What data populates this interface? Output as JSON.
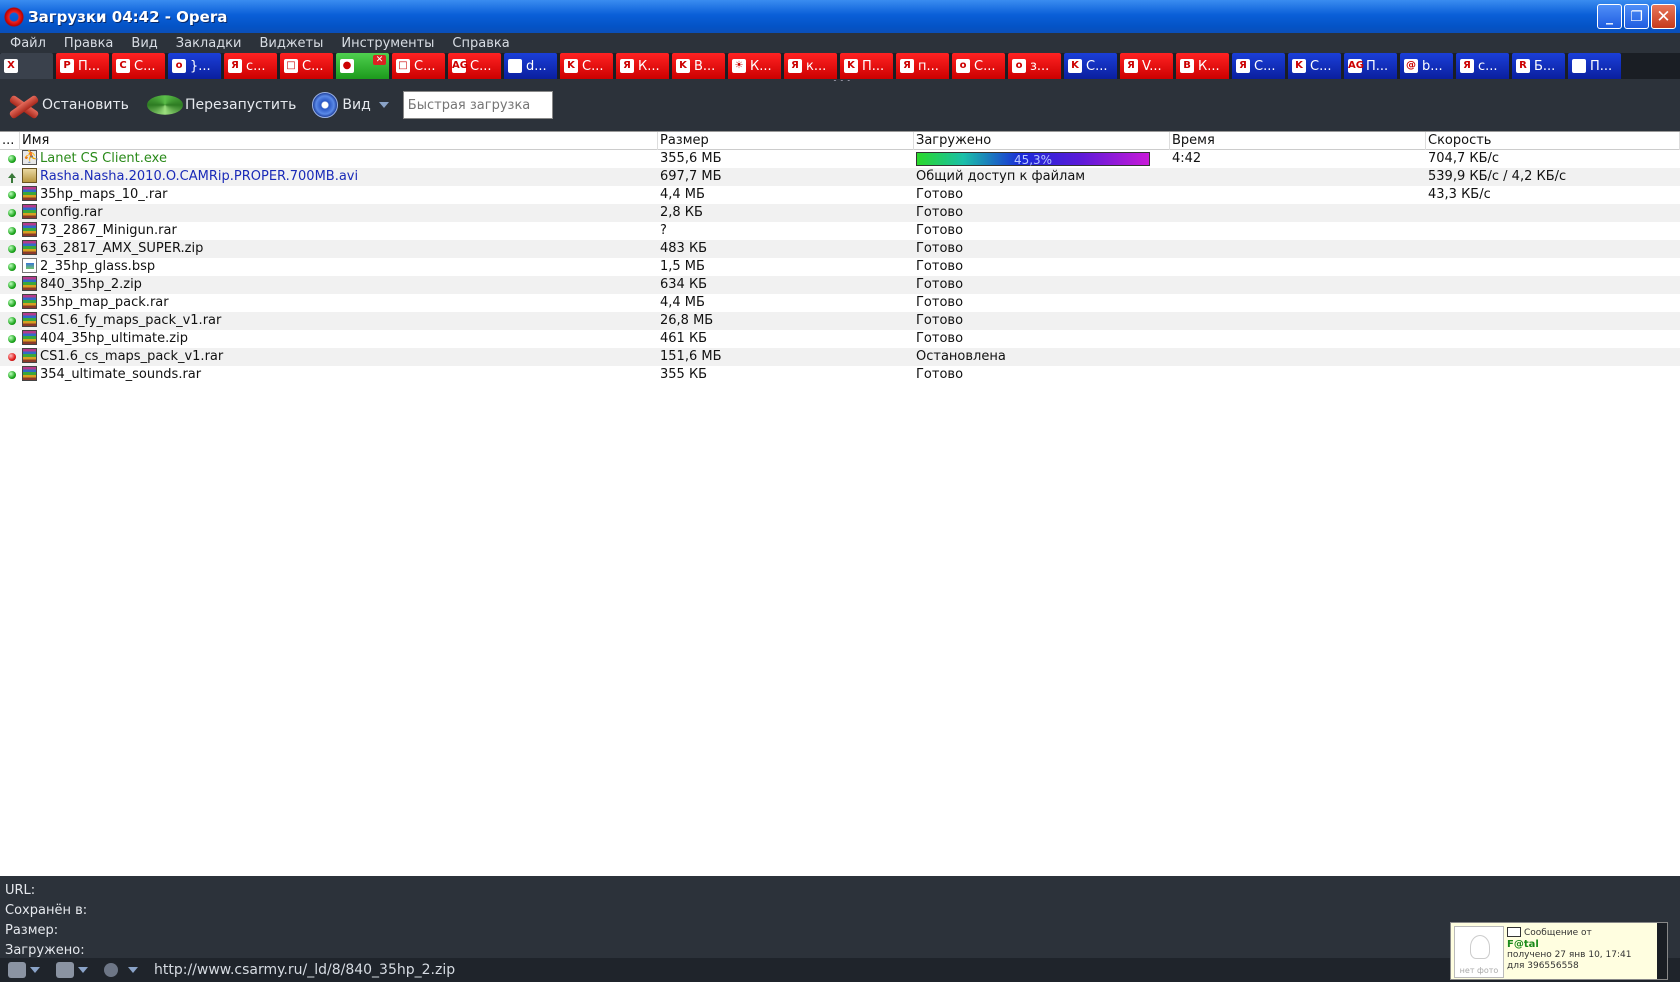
{
  "window": {
    "title": "Загрузки 04:42 - Opera",
    "min": "_",
    "max": "❐",
    "close": "✕"
  },
  "menu": [
    "Файл",
    "Правка",
    "Вид",
    "Закладки",
    "Виджеты",
    "Инструменты",
    "Справка"
  ],
  "tabs": [
    {
      "icon": "X",
      "text": "",
      "color": "gray"
    },
    {
      "icon": "P",
      "text": "П...",
      "color": "red"
    },
    {
      "icon": "C",
      "text": "С...",
      "color": "red"
    },
    {
      "icon": "o",
      "text": "}...",
      "color": "blue"
    },
    {
      "icon": "Я",
      "text": "с...",
      "color": "red"
    },
    {
      "icon": "□",
      "text": "С...",
      "color": "red"
    },
    {
      "icon": "●",
      "text": "",
      "color": "green",
      "closable": true
    },
    {
      "icon": "□",
      "text": "С...",
      "color": "red"
    },
    {
      "icon": "AG",
      "text": "С...",
      "color": "red"
    },
    {
      "icon": "",
      "text": "d...",
      "color": "blue"
    },
    {
      "icon": "K",
      "text": "С...",
      "color": "red"
    },
    {
      "icon": "Я",
      "text": "К...",
      "color": "red"
    },
    {
      "icon": "K",
      "text": "В...",
      "color": "red"
    },
    {
      "icon": "☀",
      "text": "К...",
      "color": "red"
    },
    {
      "icon": "Я",
      "text": "к...",
      "color": "red"
    },
    {
      "icon": "K",
      "text": "П...",
      "color": "red"
    },
    {
      "icon": "Я",
      "text": "п...",
      "color": "red"
    },
    {
      "icon": "o",
      "text": "С...",
      "color": "red"
    },
    {
      "icon": "o",
      "text": "з...",
      "color": "red"
    },
    {
      "icon": "K",
      "text": "С...",
      "color": "blue"
    },
    {
      "icon": "Я",
      "text": "V...",
      "color": "red"
    },
    {
      "icon": "B",
      "text": "К...",
      "color": "red"
    },
    {
      "icon": "Я",
      "text": "С...",
      "color": "blue"
    },
    {
      "icon": "K",
      "text": "С...",
      "color": "blue"
    },
    {
      "icon": "AG",
      "text": "П...",
      "color": "blue"
    },
    {
      "icon": "@",
      "text": "b...",
      "color": "blue"
    },
    {
      "icon": "Я",
      "text": "с...",
      "color": "blue"
    },
    {
      "icon": "R",
      "text": "Б...",
      "color": "blue"
    },
    {
      "icon": "",
      "text": "П...",
      "color": "blue"
    }
  ],
  "toolbar": {
    "stop_label": "Остановить",
    "restart_label": "Перезапустить",
    "view_label": "Вид",
    "quick_placeholder": "Быстрая загрузка"
  },
  "columns": {
    "dots": "...",
    "name": "Имя",
    "size": "Размер",
    "loaded": "Загружено",
    "time": "Время",
    "speed": "Скорость"
  },
  "downloads": [
    {
      "status": "green",
      "icon": "exe",
      "name": "Lanet CS Client.exe",
      "name_color": "green",
      "size": "355,6 МБ",
      "progress": 45.3,
      "progress_label": "45,3%",
      "loaded": "",
      "time": "4:42",
      "speed": "704,7 КБ/с"
    },
    {
      "status": "up",
      "icon": "avi",
      "name": "Rasha.Nasha.2010.O.CAMRip.PROPER.700MB.avi",
      "name_color": "blue",
      "size": "697,7 МБ",
      "loaded": "Общий доступ к файлам",
      "time": "",
      "speed": "539,9 КБ/с / 4,2 КБ/с"
    },
    {
      "status": "green",
      "icon": "rar",
      "name": "35hp_maps_10_.rar",
      "size": "4,4 МБ",
      "loaded": "Готово",
      "time": "",
      "speed": "43,3 КБ/с"
    },
    {
      "status": "green",
      "icon": "rar",
      "name": "config.rar",
      "size": "2,8 КБ",
      "loaded": "Готово",
      "time": "",
      "speed": ""
    },
    {
      "status": "green",
      "icon": "rar",
      "name": "73_2867_Minigun.rar",
      "size": "?",
      "loaded": "Готово",
      "time": "",
      "speed": ""
    },
    {
      "status": "green",
      "icon": "rar",
      "name": "63_2817_AMX_SUPER.zip",
      "size": "483 КБ",
      "loaded": "Готово",
      "time": "",
      "speed": ""
    },
    {
      "status": "green",
      "icon": "bsp",
      "name": "2_35hp_glass.bsp",
      "size": "1,5 МБ",
      "loaded": "Готово",
      "time": "",
      "speed": ""
    },
    {
      "status": "green",
      "icon": "rar",
      "name": "840_35hp_2.zip",
      "size": "634 КБ",
      "loaded": "Готово",
      "time": "",
      "speed": ""
    },
    {
      "status": "green",
      "icon": "rar",
      "name": "35hp_map_pack.rar",
      "size": "4,4 МБ",
      "loaded": "Готово",
      "time": "",
      "speed": ""
    },
    {
      "status": "green",
      "icon": "rar",
      "name": "CS1.6_fy_maps_pack_v1.rar",
      "size": "26,8 МБ",
      "loaded": "Готово",
      "time": "",
      "speed": ""
    },
    {
      "status": "green",
      "icon": "rar",
      "name": "404_35hp_ultimate.zip",
      "size": "461 КБ",
      "loaded": "Готово",
      "time": "",
      "speed": ""
    },
    {
      "status": "red",
      "icon": "rar",
      "name": "CS1.6_cs_maps_pack_v1.rar",
      "size": "151,6 МБ",
      "loaded": "Остановлена",
      "time": "",
      "speed": ""
    },
    {
      "status": "green",
      "icon": "rar",
      "name": "354_ultimate_sounds.rar",
      "size": "355 КБ",
      "loaded": "Готово",
      "time": "",
      "speed": ""
    }
  ],
  "details": {
    "url_label": "URL:",
    "saved_label": "Сохранён в:",
    "size_label": "Размер:",
    "loaded_label": "Загружено:"
  },
  "statusbar": {
    "url": "http://www.csarmy.ru/_ld/8/840_35hp_2.zip"
  },
  "notification": {
    "photo_label": "нет фото",
    "title": "Сообщение от",
    "from": "F@tal",
    "received": "получено  27 янв 10, 17:41",
    "for": "для 396556558"
  }
}
